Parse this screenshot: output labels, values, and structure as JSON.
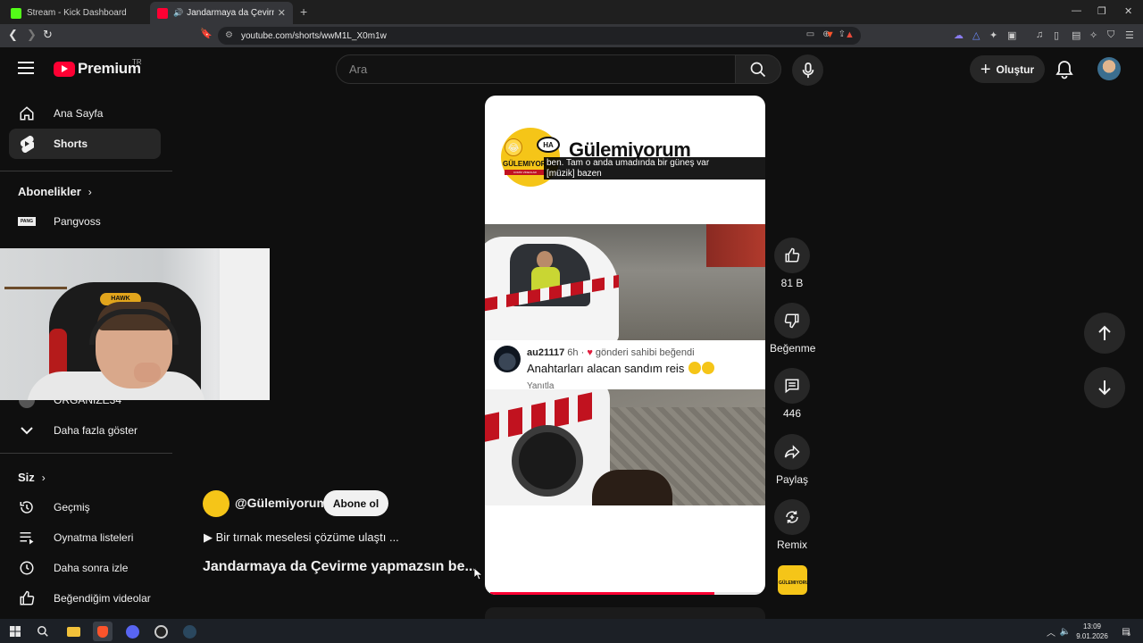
{
  "browser": {
    "tabs": [
      {
        "title": "Stream - Kick Dashboard",
        "favicon_color": "#53fc18"
      },
      {
        "title": "Jandarmaya da Çevirme yapmazsın be...",
        "favicon_color": "#ff0033"
      }
    ],
    "url": "youtube.com/shorts/wwM1L_X0m1w"
  },
  "header": {
    "logo_text": "Premium",
    "country": "TR",
    "search_placeholder": "Ara",
    "create_label": "Oluştur"
  },
  "sidebar": {
    "main": [
      {
        "label": "Ana Sayfa",
        "icon": "home-icon"
      },
      {
        "label": "Shorts",
        "icon": "shorts-icon",
        "active": true
      }
    ],
    "subscriptions_title": "Abonelikler",
    "subscriptions": [
      {
        "label": "Pangvoss",
        "icon_text": "PANG"
      },
      {
        "label": "ORGANIZE34"
      }
    ],
    "show_more": "Daha fazla göster",
    "you_title": "Siz",
    "you": [
      {
        "label": "Geçmiş",
        "icon": "history-icon"
      },
      {
        "label": "Oynatma listeleri",
        "icon": "playlist-icon"
      },
      {
        "label": "Daha sonra izle",
        "icon": "watch-later-icon"
      },
      {
        "label": "Beğendiğim videolar",
        "icon": "like-icon"
      }
    ]
  },
  "short": {
    "overlay_channel": "Gülemiyorum",
    "logo_bubble": "HA",
    "logo_word": "GÜLEMIYORUM",
    "logo_strip": "KOMİK VİDEOLAR",
    "caption_line1": "ben. Tam o anda umadında bir güneş var",
    "caption_line2": "[müzik] bazen",
    "comment": {
      "user": "au21117",
      "time": "6h",
      "liked_by_creator": "gönderi sahibi beğendi",
      "text": "Anahtarları alacan sandım reis",
      "reply": "Yanıtla"
    },
    "progress_fraction": 0.83,
    "channel_handle": "@Gülemiyorum",
    "subscribe_label": "Abone ol",
    "description": "▶ Bir tırnak meselesi çözüme ulaştı ...",
    "title": "Jandarmaya da Çevirme yapmazsın be..."
  },
  "actions": {
    "like_count": "81 B",
    "dislike_label": "Beğenme",
    "comment_count": "446",
    "share_label": "Paylaş",
    "remix_label": "Remix"
  },
  "webcam": {
    "logo_text": "HAWK"
  },
  "taskbar": {
    "time": "13:09",
    "date": "9.01.2026",
    "notif_count": "6"
  },
  "colors": {
    "accent": "#ff0033",
    "chip": "#272727",
    "background": "#0f0f0f"
  }
}
